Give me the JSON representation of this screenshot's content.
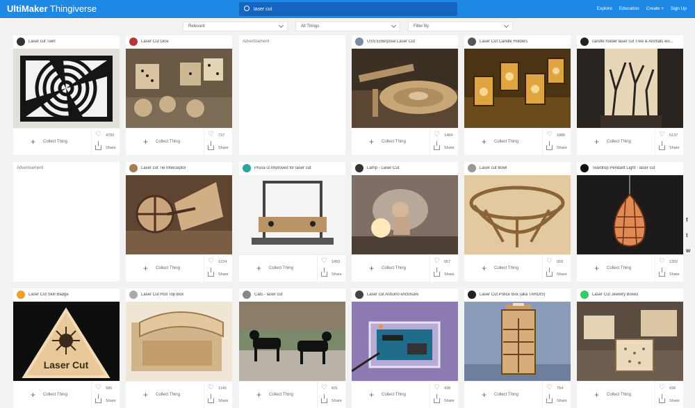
{
  "header": {
    "brand_bold": "UltiMaker",
    "brand_light": "Thingiverse",
    "search_value": "laser cut",
    "nav": [
      "Explore",
      "Education",
      "Create +",
      "Sign Up"
    ]
  },
  "filters": [
    "Relevant",
    "All Things",
    "Filter By"
  ],
  "card_actions": {
    "collect": "Collect Thing",
    "share": "Share"
  },
  "ad_label": "Advertisement",
  "cards": [
    {
      "title": "Laser cut Twirl",
      "likes": "4783"
    },
    {
      "title": "Laser Cut Dice",
      "likes": "737"
    },
    {
      "title": "USS Enterprise Laser Cut",
      "likes": "1484"
    },
    {
      "title": "Laser Cut Candle Holders",
      "likes": "1886"
    },
    {
      "title": "candle holder laser cut Tree & Animals wo...",
      "likes": "5137"
    },
    {
      "title": "Laser cut Tie Interceptor",
      "likes": "1224"
    },
    {
      "title": "Prusa i3 Improved for laser cut",
      "likes": "1493"
    },
    {
      "title": "Lamp - Laser Cut",
      "likes": "657"
    },
    {
      "title": "Laser cut Bowl",
      "likes": "918"
    },
    {
      "title": "Teardrop Pendant Light - laser cut",
      "likes": "1302"
    },
    {
      "title": "Laser Cut Skill Badge",
      "likes": "586"
    },
    {
      "title": "Laser Cut Roll Top Box",
      "likes": "1145"
    },
    {
      "title": "Cats - laser cut",
      "likes": "831"
    },
    {
      "title": "Laser cut Arduino enclosure",
      "likes": "438"
    },
    {
      "title": "Laser Cut Police Box (aka TARDIS)",
      "likes": "754"
    },
    {
      "title": "Laser Cut Jewelry Boxes",
      "likes": "698"
    }
  ],
  "badge_text": "Laser Cut",
  "social": [
    "f",
    "t",
    "w"
  ]
}
